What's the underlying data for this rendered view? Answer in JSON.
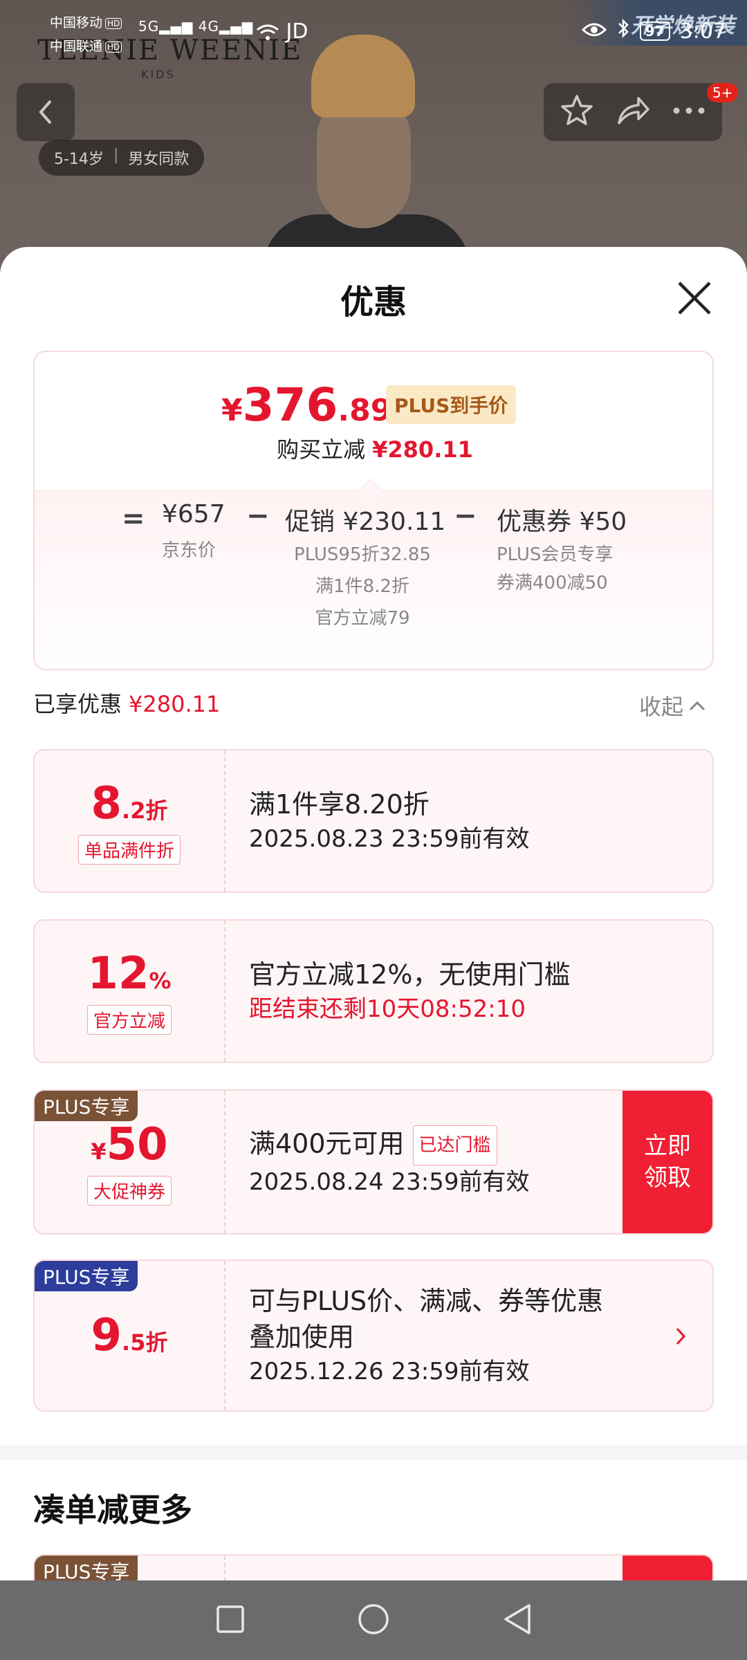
{
  "status_bar": {
    "carrier1": "中国移动",
    "carrier2": "中国联通",
    "hd": "HD",
    "signal_1": "5G",
    "signal_2": "4G",
    "app_icon": "JD",
    "battery": "97",
    "time": "3:07"
  },
  "background": {
    "brand": "TEENIE WEENIE",
    "brand_sub": "KIDS",
    "corner_promo": "开学焕新装",
    "age_range": "5-14岁",
    "gender": "男女同款",
    "notification_count": "5+"
  },
  "sheet": {
    "title": "优惠"
  },
  "price_card": {
    "currency": "¥",
    "final_int": "376",
    "final_dec": ".89",
    "plus_label": "PLUS到手价",
    "reduce_label": "购买立减",
    "reduce_value": "¥280.11",
    "eq": "=",
    "minus": "−",
    "jd_price": "¥657",
    "jd_price_label": "京东价",
    "promo_label": "促销 ¥230.11",
    "promo_lines": [
      "PLUS95折32.85",
      "满1件8.2折",
      "官方立减79"
    ],
    "coupon_label": "优惠券 ¥50",
    "coupon_lines": [
      "PLUS会员专享",
      "券满400减50"
    ]
  },
  "enjoyed": {
    "label": "已享优惠",
    "value": "¥280.11",
    "collapse": "收起"
  },
  "promos": [
    {
      "big": "8",
      "small": ".2折",
      "tag": "单品满件折",
      "title": "满1件享8.20折",
      "sub": "2025.08.23 23:59前有效"
    },
    {
      "big": "12",
      "small": "%",
      "tag": "官方立减",
      "title": "官方立减12%，无使用门槛",
      "sub": "距结束还剩10天08:52:10"
    },
    {
      "corner": "PLUS专享",
      "sym": "¥",
      "big": "50",
      "tag": "大促神券",
      "title": "满400元可用",
      "reach": "已达门槛",
      "sub": "2025.08.24 23:59前有效",
      "button": "立即领取",
      "button_l1": "立即",
      "button_l2": "领取"
    },
    {
      "corner": "PLUS专享",
      "big": "9",
      "small": ".5折",
      "title_l1": "可与PLUS价、满减、券等优惠",
      "title_l2": "叠加使用",
      "sub": "2025.12.26 23:59前有效"
    }
  ],
  "more": {
    "title": "凑单减更多",
    "corner": "PLUS专享"
  },
  "colors": {
    "accent_red": "#e4162f",
    "plus_brown": "#7a5236",
    "plus_blue": "#2c3d9c"
  }
}
